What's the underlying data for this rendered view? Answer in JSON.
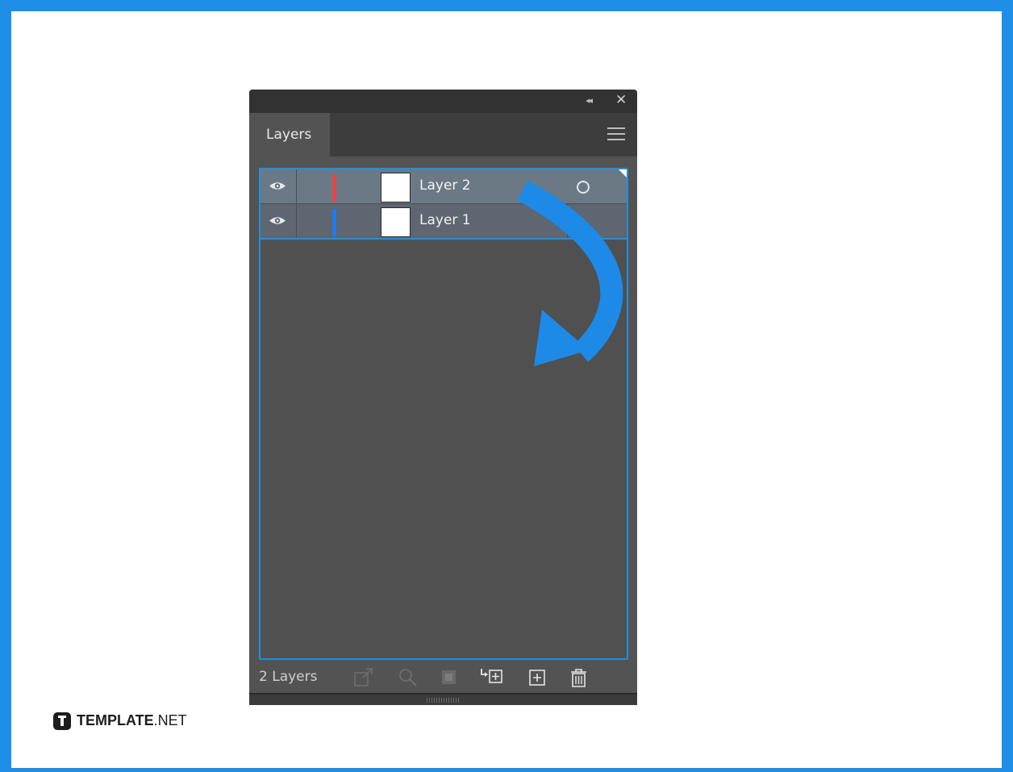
{
  "panel": {
    "collapse_glyph": "◂◂",
    "close_glyph": "✕",
    "tab_label": "Layers",
    "menu_icon": "hamburger-icon"
  },
  "layers": [
    {
      "name": "Layer 2",
      "color": "#e04646",
      "selected": true,
      "visible": true
    },
    {
      "name": "Layer 1",
      "color": "#1e7bf0",
      "selected": false,
      "visible": true
    }
  ],
  "footer": {
    "count_label": "2 Layers",
    "buttons": [
      "export-icon",
      "locate-object-icon",
      "make-clipping-mask-icon",
      "create-sublayer-icon",
      "new-layer-icon",
      "delete-icon"
    ]
  },
  "colors": {
    "frame": "#1e8ee6",
    "panel_bg": "#535353",
    "selection": "#1e90e0",
    "arrow": "#1d8ae8"
  },
  "logo": {
    "brand": "TEMPLATE",
    "suffix": ".NET"
  }
}
